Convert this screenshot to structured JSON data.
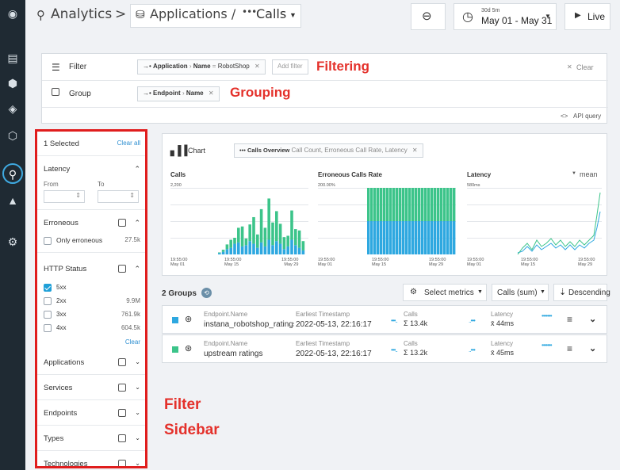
{
  "topbar": {
    "crumb_analytics": "Analytics",
    "crumb_sep": ">",
    "crumb_applications": "Applications /",
    "crumb_calls": "Calls",
    "time_small": "30d 5m",
    "time_range": "May 01 - May 31",
    "live_label": "Live"
  },
  "panel": {
    "filter_label": "Filter",
    "filter_pill_key": "Application",
    "filter_pill_field": "Name",
    "filter_pill_op": "=",
    "filter_pill_value": "RobotShop",
    "add_filter": "Add filter",
    "clear": "Clear",
    "group_label": "Group",
    "group_pill_key": "Endpoint",
    "group_pill_field": "Name",
    "api_query": "API query"
  },
  "annotations": {
    "filtering": "Filtering",
    "grouping": "Grouping",
    "filter_line1": "Filter",
    "filter_line2": "Sidebar"
  },
  "sidebar": {
    "selected": "1 Selected",
    "clear_all": "Clear all",
    "latency": "Latency",
    "from": "From",
    "to": "To",
    "erroneous": "Erroneous",
    "only_erroneous": "Only erroneous",
    "only_erroneous_count": "27.5k",
    "http_status": "HTTP Status",
    "statuses": [
      {
        "label": "5xx",
        "count": ""
      },
      {
        "label": "2xx",
        "count": "9.9M"
      },
      {
        "label": "3xx",
        "count": "761.9k"
      },
      {
        "label": "4xx",
        "count": "604.5k"
      }
    ],
    "clear": "Clear",
    "applications": "Applications",
    "services": "Services",
    "endpoints": "Endpoints",
    "types": "Types",
    "technologies": "Technologies"
  },
  "chartcard": {
    "chart_label": "Chart",
    "overview_bold": "Calls Overview",
    "overview_rest": "Call Count, Erroneous Call Rate, Latency",
    "mean": "mean"
  },
  "chart_data": [
    {
      "type": "bar",
      "title": "Calls",
      "ymax_label": "2,200",
      "x_ticks": [
        [
          "19:55:00",
          "May 01"
        ],
        [
          "19:55:00",
          "May 15"
        ],
        [
          "19:55:00",
          "May 29"
        ]
      ],
      "series_colors": [
        "#2ea8e0",
        "#3cc48a"
      ],
      "stacks": [
        [
          2,
          1
        ],
        [
          4,
          3
        ],
        [
          8,
          7
        ],
        [
          10,
          12
        ],
        [
          16,
          9
        ],
        [
          18,
          22
        ],
        [
          12,
          30
        ],
        [
          14,
          10
        ],
        [
          20,
          25
        ],
        [
          16,
          40
        ],
        [
          10,
          20
        ],
        [
          18,
          50
        ],
        [
          12,
          28
        ],
        [
          22,
          62
        ],
        [
          14,
          34
        ],
        [
          20,
          45
        ],
        [
          16,
          30
        ],
        [
          8,
          18
        ],
        [
          12,
          16
        ],
        [
          22,
          44
        ],
        [
          14,
          24
        ],
        [
          10,
          26
        ],
        [
          6,
          14
        ]
      ]
    },
    {
      "type": "bar",
      "title": "Erroneous Calls Rate",
      "ymax_label": "200.00%",
      "x_ticks": [
        [
          "19:55:00",
          "May 01"
        ],
        [
          "19:55:00",
          "May 15"
        ],
        [
          "19:55:00",
          "May 29"
        ]
      ],
      "series_colors": [
        "#2ea8e0",
        "#3cc48a"
      ],
      "split": [
        50,
        50
      ]
    },
    {
      "type": "line",
      "title": "Latency",
      "ymax_label": "580ms",
      "x_ticks": [
        [
          "19:55:00",
          "May 01"
        ],
        [
          "19:55:00",
          "May 15"
        ],
        [
          "19:55:00",
          "May 29"
        ]
      ],
      "series_colors": [
        "#2ea8e0",
        "#3cc48a"
      ]
    }
  ],
  "groups": {
    "title": "2 Groups",
    "select_metrics": "Select metrics",
    "calls_sum": "Calls (sum)",
    "descending": "Descending",
    "rows": [
      {
        "color": "#2ea8e0",
        "key": "Endpoint.Name",
        "name": "instana_robotshop_ratings_r",
        "ts_label": "Earliest Timestamp",
        "ts": "2022-05-13, 22:16:17",
        "calls_label": "Calls",
        "calls": "Σ 13.4k",
        "lat_label": "Latency",
        "lat": "x̄ 44ms"
      },
      {
        "color": "#3cc48a",
        "key": "Endpoint.Name",
        "name": "upstream ratings",
        "ts_label": "Earliest Timestamp",
        "ts": "2022-05-13, 22:16:17",
        "calls_label": "Calls",
        "calls": "Σ 13.2k",
        "lat_label": "Latency",
        "lat": "x̄ 45ms"
      }
    ]
  }
}
